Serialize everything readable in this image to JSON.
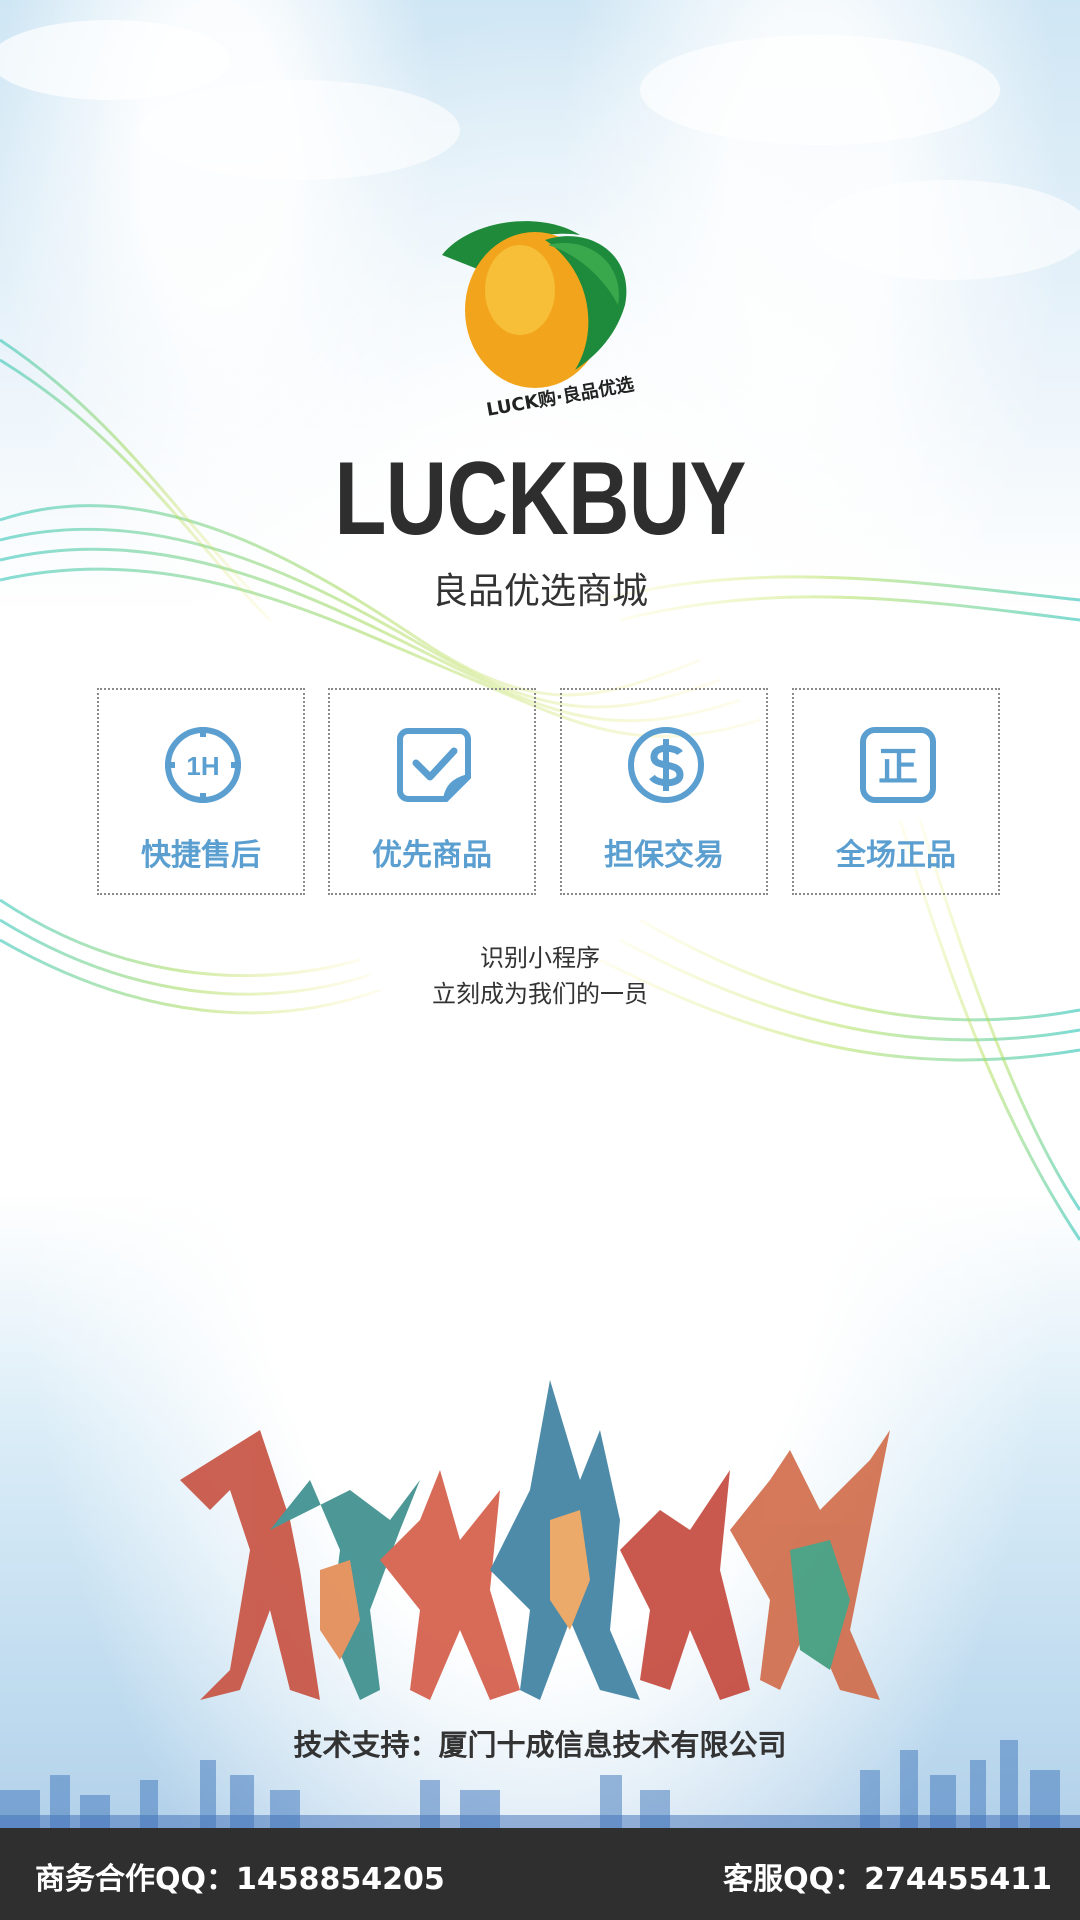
{
  "logo": {
    "caption": "LUCK购·良品优选"
  },
  "brand": {
    "name": "LUCKBUY",
    "subtitle": "良品优选商城"
  },
  "features": [
    {
      "icon": "1h-clock-icon",
      "label": "快捷售后"
    },
    {
      "icon": "checkbox-doc-icon",
      "label": "优先商品"
    },
    {
      "icon": "dollar-coin-icon",
      "label": "担保交易"
    },
    {
      "icon": "genuine-badge-icon",
      "label": "全场正品"
    }
  ],
  "invite": {
    "line1": "识别小程序",
    "line2": "立刻成为我们的一员"
  },
  "support": "技术支持：厦门十成信息技术有限公司",
  "footer": {
    "business": "商务合作QQ：1458854205",
    "service": "客服QQ：274455411"
  },
  "colors": {
    "accent": "#5b9fd1",
    "footer_bg": "#2f2f2f",
    "brand_text": "#2e2e2e"
  }
}
